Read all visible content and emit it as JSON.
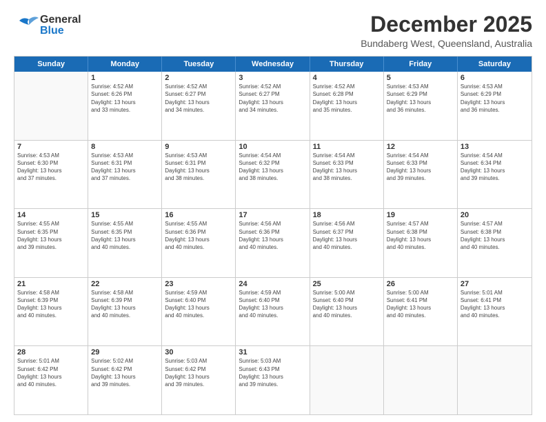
{
  "header": {
    "logo": {
      "line1": "General",
      "line2": "Blue"
    },
    "title": "December 2025",
    "location": "Bundaberg West, Queensland, Australia"
  },
  "calendar": {
    "days": [
      "Sunday",
      "Monday",
      "Tuesday",
      "Wednesday",
      "Thursday",
      "Friday",
      "Saturday"
    ],
    "weeks": [
      [
        {
          "day": "",
          "info": ""
        },
        {
          "day": "1",
          "info": "Sunrise: 4:52 AM\nSunset: 6:26 PM\nDaylight: 13 hours\nand 33 minutes."
        },
        {
          "day": "2",
          "info": "Sunrise: 4:52 AM\nSunset: 6:27 PM\nDaylight: 13 hours\nand 34 minutes."
        },
        {
          "day": "3",
          "info": "Sunrise: 4:52 AM\nSunset: 6:27 PM\nDaylight: 13 hours\nand 34 minutes."
        },
        {
          "day": "4",
          "info": "Sunrise: 4:52 AM\nSunset: 6:28 PM\nDaylight: 13 hours\nand 35 minutes."
        },
        {
          "day": "5",
          "info": "Sunrise: 4:53 AM\nSunset: 6:29 PM\nDaylight: 13 hours\nand 36 minutes."
        },
        {
          "day": "6",
          "info": "Sunrise: 4:53 AM\nSunset: 6:29 PM\nDaylight: 13 hours\nand 36 minutes."
        }
      ],
      [
        {
          "day": "7",
          "info": "Sunrise: 4:53 AM\nSunset: 6:30 PM\nDaylight: 13 hours\nand 37 minutes."
        },
        {
          "day": "8",
          "info": "Sunrise: 4:53 AM\nSunset: 6:31 PM\nDaylight: 13 hours\nand 37 minutes."
        },
        {
          "day": "9",
          "info": "Sunrise: 4:53 AM\nSunset: 6:31 PM\nDaylight: 13 hours\nand 38 minutes."
        },
        {
          "day": "10",
          "info": "Sunrise: 4:54 AM\nSunset: 6:32 PM\nDaylight: 13 hours\nand 38 minutes."
        },
        {
          "day": "11",
          "info": "Sunrise: 4:54 AM\nSunset: 6:33 PM\nDaylight: 13 hours\nand 38 minutes."
        },
        {
          "day": "12",
          "info": "Sunrise: 4:54 AM\nSunset: 6:33 PM\nDaylight: 13 hours\nand 39 minutes."
        },
        {
          "day": "13",
          "info": "Sunrise: 4:54 AM\nSunset: 6:34 PM\nDaylight: 13 hours\nand 39 minutes."
        }
      ],
      [
        {
          "day": "14",
          "info": "Sunrise: 4:55 AM\nSunset: 6:35 PM\nDaylight: 13 hours\nand 39 minutes."
        },
        {
          "day": "15",
          "info": "Sunrise: 4:55 AM\nSunset: 6:35 PM\nDaylight: 13 hours\nand 40 minutes."
        },
        {
          "day": "16",
          "info": "Sunrise: 4:55 AM\nSunset: 6:36 PM\nDaylight: 13 hours\nand 40 minutes."
        },
        {
          "day": "17",
          "info": "Sunrise: 4:56 AM\nSunset: 6:36 PM\nDaylight: 13 hours\nand 40 minutes."
        },
        {
          "day": "18",
          "info": "Sunrise: 4:56 AM\nSunset: 6:37 PM\nDaylight: 13 hours\nand 40 minutes."
        },
        {
          "day": "19",
          "info": "Sunrise: 4:57 AM\nSunset: 6:38 PM\nDaylight: 13 hours\nand 40 minutes."
        },
        {
          "day": "20",
          "info": "Sunrise: 4:57 AM\nSunset: 6:38 PM\nDaylight: 13 hours\nand 40 minutes."
        }
      ],
      [
        {
          "day": "21",
          "info": "Sunrise: 4:58 AM\nSunset: 6:39 PM\nDaylight: 13 hours\nand 40 minutes."
        },
        {
          "day": "22",
          "info": "Sunrise: 4:58 AM\nSunset: 6:39 PM\nDaylight: 13 hours\nand 40 minutes."
        },
        {
          "day": "23",
          "info": "Sunrise: 4:59 AM\nSunset: 6:40 PM\nDaylight: 13 hours\nand 40 minutes."
        },
        {
          "day": "24",
          "info": "Sunrise: 4:59 AM\nSunset: 6:40 PM\nDaylight: 13 hours\nand 40 minutes."
        },
        {
          "day": "25",
          "info": "Sunrise: 5:00 AM\nSunset: 6:40 PM\nDaylight: 13 hours\nand 40 minutes."
        },
        {
          "day": "26",
          "info": "Sunrise: 5:00 AM\nSunset: 6:41 PM\nDaylight: 13 hours\nand 40 minutes."
        },
        {
          "day": "27",
          "info": "Sunrise: 5:01 AM\nSunset: 6:41 PM\nDaylight: 13 hours\nand 40 minutes."
        }
      ],
      [
        {
          "day": "28",
          "info": "Sunrise: 5:01 AM\nSunset: 6:42 PM\nDaylight: 13 hours\nand 40 minutes."
        },
        {
          "day": "29",
          "info": "Sunrise: 5:02 AM\nSunset: 6:42 PM\nDaylight: 13 hours\nand 39 minutes."
        },
        {
          "day": "30",
          "info": "Sunrise: 5:03 AM\nSunset: 6:42 PM\nDaylight: 13 hours\nand 39 minutes."
        },
        {
          "day": "31",
          "info": "Sunrise: 5:03 AM\nSunset: 6:43 PM\nDaylight: 13 hours\nand 39 minutes."
        },
        {
          "day": "",
          "info": ""
        },
        {
          "day": "",
          "info": ""
        },
        {
          "day": "",
          "info": ""
        }
      ]
    ]
  }
}
